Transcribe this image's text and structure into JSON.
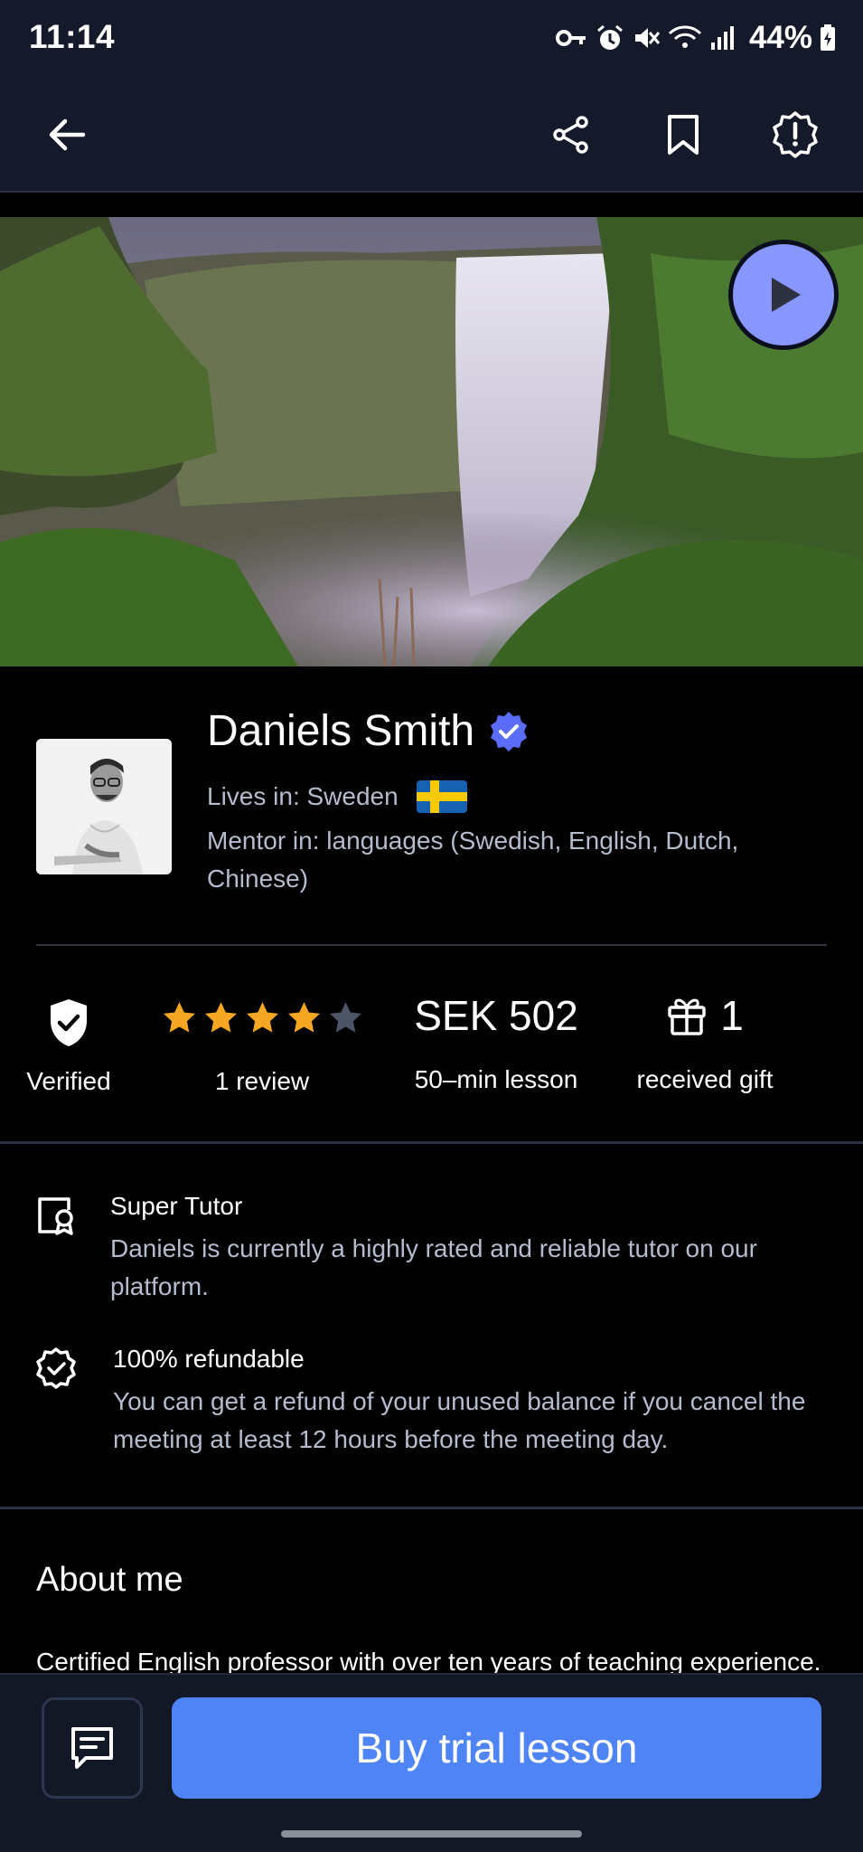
{
  "status_bar": {
    "time": "11:14",
    "battery": "44%"
  },
  "profile": {
    "name": "Daniels Smith",
    "lives_in": "Lives in: Sweden",
    "mentor_in": "Mentor in: languages (Swedish, English, Dutch, Chinese)"
  },
  "stats": {
    "verified_label": "Verified",
    "rating": 4,
    "rating_max": 5,
    "reviews_label": "1 review",
    "price": "SEK 502",
    "price_label": "50–min lesson",
    "gifts_count": "1",
    "gifts_label": "received gift"
  },
  "features": [
    {
      "title": "Super Tutor",
      "description": "Daniels is currently a highly rated and reliable tutor on our platform.",
      "icon": "certificate-icon"
    },
    {
      "title": "100% refundable",
      "description": "You can get a refund of your unused balance if you cancel the meeting at least 12 hours before the meeting day.",
      "icon": "badge-check-icon"
    }
  ],
  "about": {
    "title": "About me",
    "text": "Certified English professor with over ten years of teaching experience."
  },
  "actions": {
    "buy_label": "Buy trial lesson"
  },
  "colors": {
    "accent": "#4f84f7",
    "star": "#f5a623",
    "play": "#8896ff",
    "verified_badge": "#5b6df8"
  }
}
